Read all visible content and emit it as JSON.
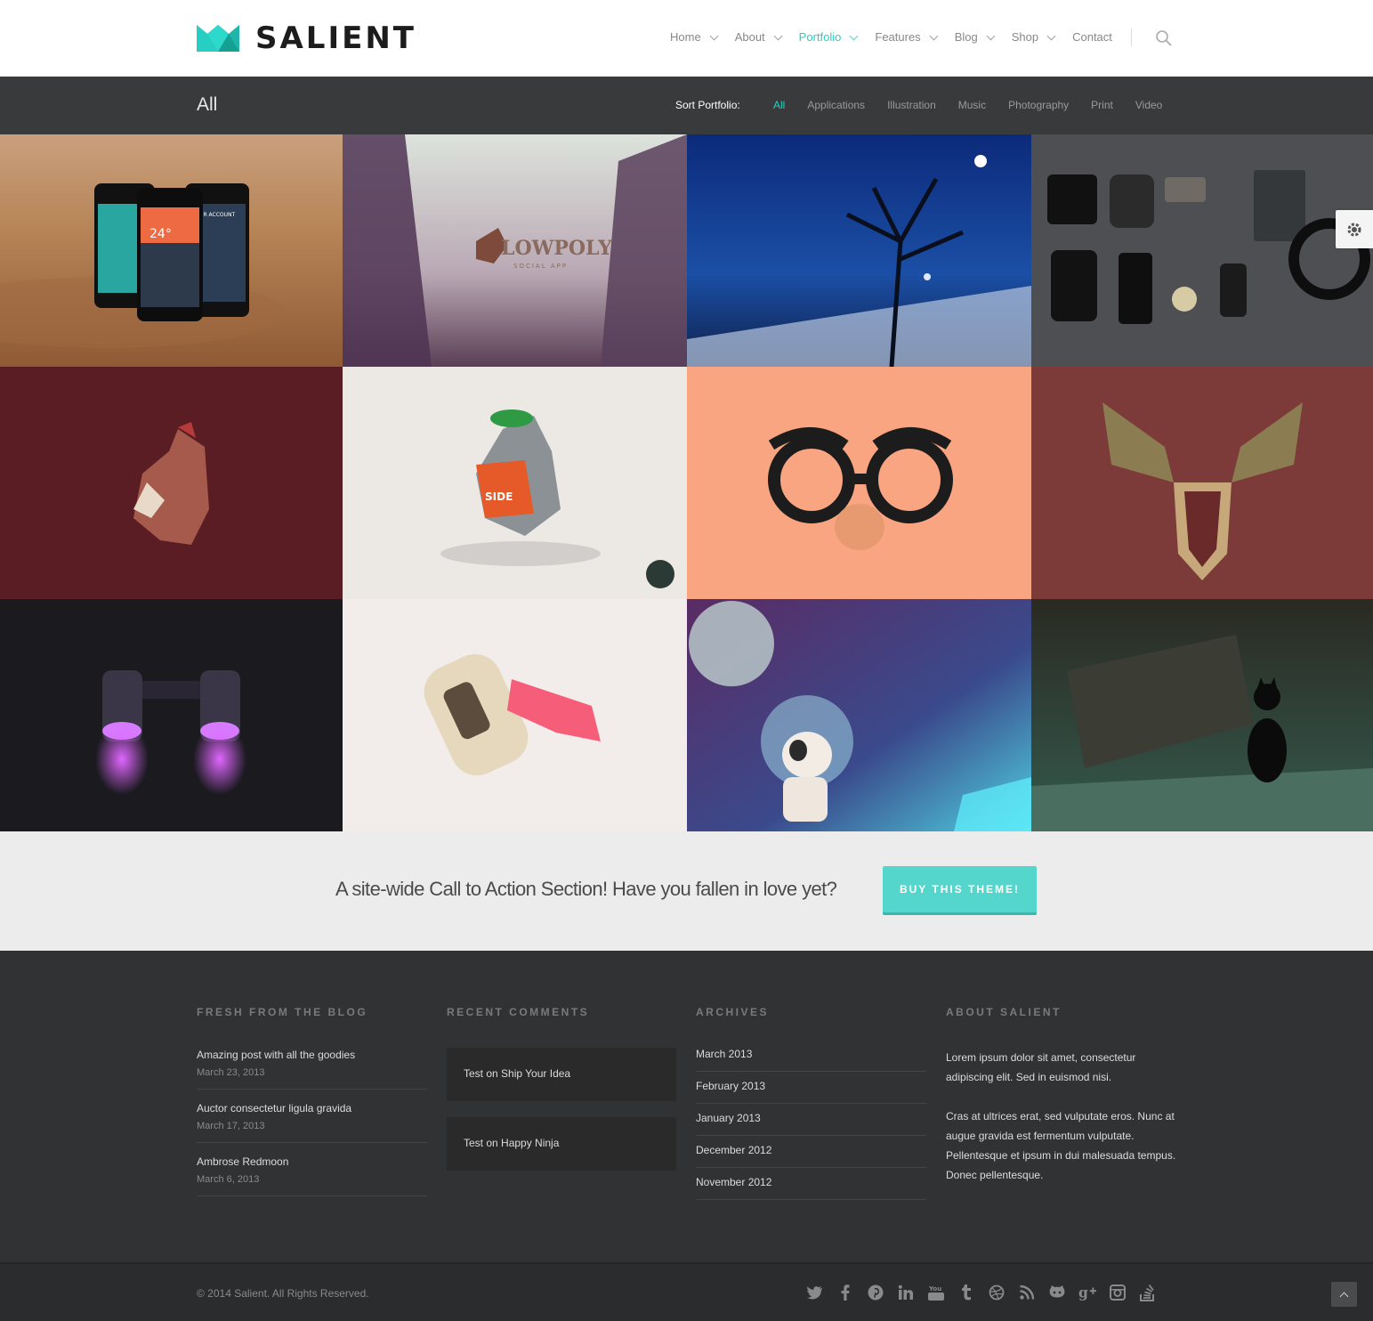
{
  "brand": {
    "name": "SALIENT",
    "accent": "#27CFC3"
  },
  "nav": {
    "items": [
      {
        "label": "Home"
      },
      {
        "label": "About"
      },
      {
        "label": "Portfolio"
      },
      {
        "label": "Features"
      },
      {
        "label": "Blog"
      },
      {
        "label": "Shop"
      },
      {
        "label": "Contact"
      }
    ],
    "active": "Portfolio"
  },
  "portfolio": {
    "title": "All",
    "sort_label": "Sort Portfolio:",
    "filters": [
      "All",
      "Applications",
      "Illustration",
      "Music",
      "Photography",
      "Print",
      "Video"
    ],
    "active_filter": "All"
  },
  "cta": {
    "text": "A site-wide Call to Action Section! Have you fallen in love yet?",
    "button": "BUY THIS THEME!"
  },
  "footer": {
    "blog": {
      "title": "FRESH FROM THE BLOG",
      "posts": [
        {
          "title": "Amazing post with all the goodies",
          "date": "March 23, 2013"
        },
        {
          "title": "Auctor consectetur ligula gravida",
          "date": "March 17, 2013"
        },
        {
          "title": "Ambrose Redmoon",
          "date": "March 6, 2013"
        }
      ]
    },
    "comments": {
      "title": "RECENT COMMENTS",
      "items": [
        "Test on Ship Your Idea",
        "Test on Happy Ninja"
      ]
    },
    "archives": {
      "title": "ARCHIVES",
      "items": [
        "March 2013",
        "February 2013",
        "January 2013",
        "December 2012",
        "November 2012"
      ]
    },
    "about": {
      "title": "ABOUT SALIENT",
      "paragraphs": [
        "Lorem ipsum dolor sit amet, consectetur adipiscing elit. Sed in euismod nisi.",
        "Cras at ultrices erat, sed vulputate eros. Nunc at augue gravida est fermentum vulputate. Pellentesque et ipsum in dui malesuada tempus. Donec pellentesque."
      ]
    }
  },
  "bottom": {
    "copyright": "© 2014 Salient. All Rights Reserved.",
    "socials": [
      "twitter-icon",
      "facebook-icon",
      "pinterest-icon",
      "linkedin-icon",
      "youtube-icon",
      "tumblr-icon",
      "dribbble-icon",
      "rss-icon",
      "github-icon",
      "google-plus-icon",
      "instagram-icon",
      "stackexchange-icon"
    ]
  },
  "tile_art": {
    "lowpoly": "LOWPOLY",
    "lowpoly_sub": "SOCIAL APP",
    "phone_temp": "24°",
    "phone_header": "YOUR ACCOUNT",
    "pigeon_text": "SIDE"
  }
}
